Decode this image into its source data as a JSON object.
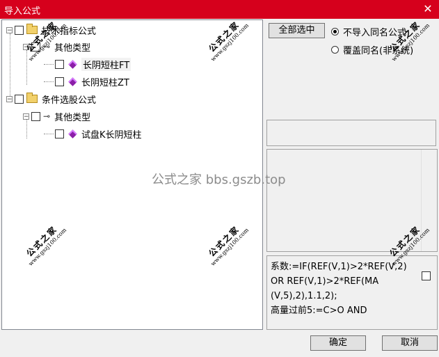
{
  "window": {
    "title": "导入公式",
    "close_glyph": "✕"
  },
  "tree": {
    "groups": [
      {
        "label": "技术指标公式",
        "toggle": "−",
        "sub": {
          "label": "其他类型",
          "toggle": "−",
          "items": [
            "长阴短柱FT",
            "长阴短柱ZT"
          ]
        }
      },
      {
        "label": "条件选股公式",
        "toggle": "−",
        "sub": {
          "label": "其他类型",
          "toggle": "−",
          "items": [
            "试盘K长阴短柱"
          ]
        }
      }
    ]
  },
  "controls": {
    "select_all": "全部选中",
    "radio_skip": "不导入同名公式",
    "radio_overwrite": "覆盖同名(非系统)",
    "selected_radio": "skip"
  },
  "formula_preview": "系数:=IF(REF(V,1)>2*REF(V,2)\nOR REF(V,1)>2*REF(MA\n(V,5),2),1.1,2);\n高量过前5:=C>O AND",
  "buttons": {
    "ok": "确定",
    "cancel": "取消"
  },
  "watermarks": {
    "cn": "公式之家",
    "url": "www.gszj100.com",
    "center": "公式之家 bbs.gszb.top"
  },
  "icons": {
    "close": "close-icon",
    "folder": "folder-icon",
    "formula": "formula-icon",
    "type": "key-icon"
  }
}
